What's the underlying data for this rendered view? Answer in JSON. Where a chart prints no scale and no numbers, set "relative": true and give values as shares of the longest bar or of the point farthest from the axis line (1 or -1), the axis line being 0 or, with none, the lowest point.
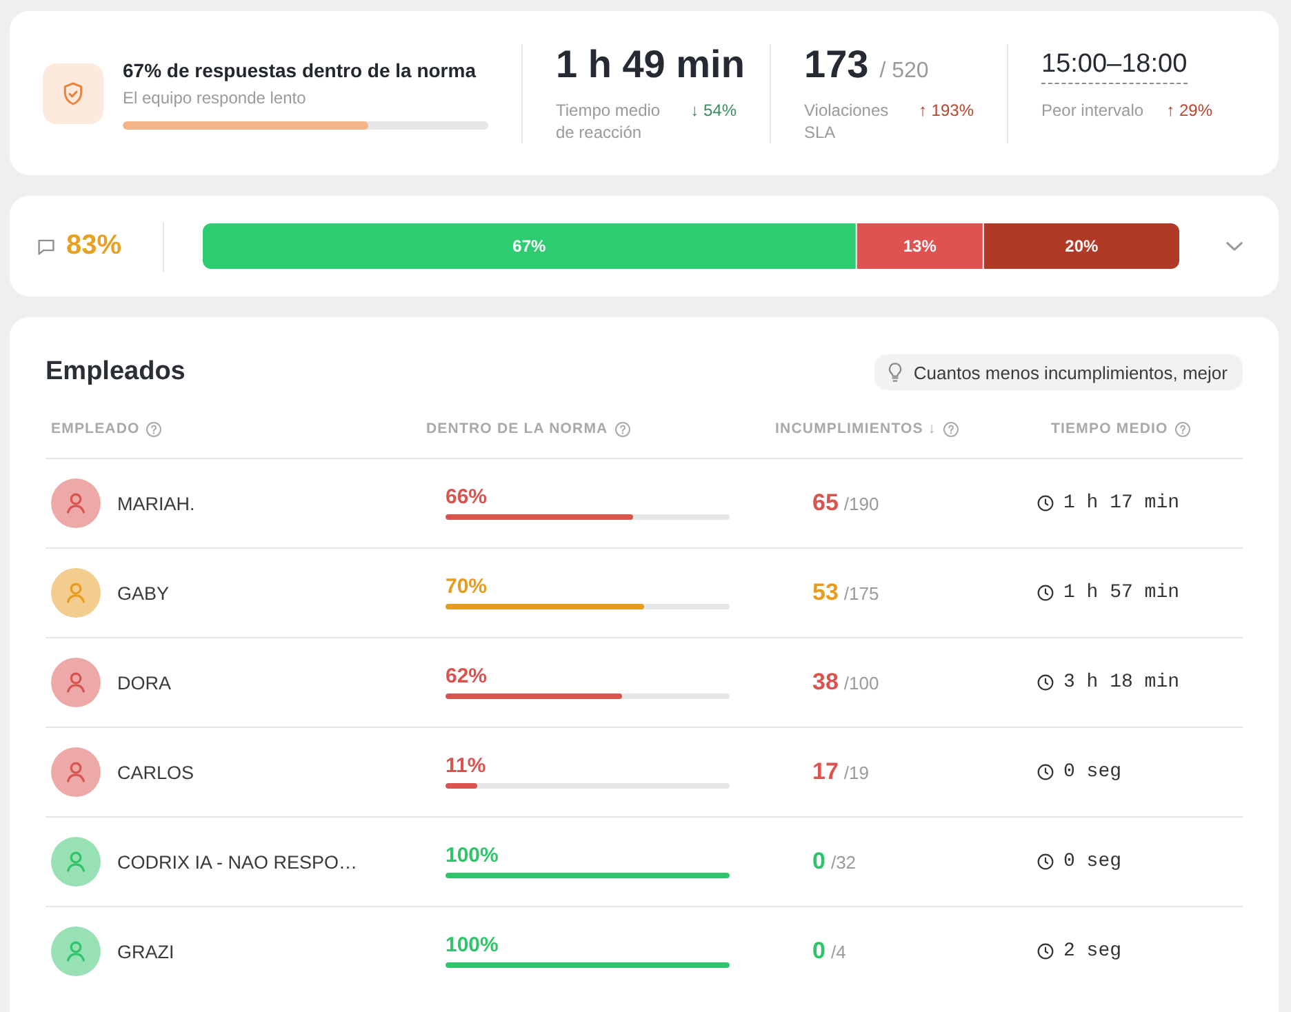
{
  "summary": {
    "title": "67% de respuestas dentro de la norma",
    "subtitle": "El equipo responde lento",
    "level": 0.67
  },
  "stats": [
    {
      "kind": "plain",
      "value": "1 h 49 min",
      "label": "Tiempo medio de reacción",
      "delta": "↓ 54%",
      "positive": true
    },
    {
      "kind": "fraction",
      "value": "173",
      "total": "/ 520",
      "label": "Violaciones SLA",
      "delta": "↑ 193%",
      "positive": false
    },
    {
      "kind": "interval",
      "value": "15:00–18:00",
      "label": "Peor intervalo",
      "delta": "↑ 29%",
      "positive": false
    }
  ],
  "response_rate": {
    "value": "83%",
    "chart_data": {
      "type": "bar",
      "orientation": "horizontal",
      "stacked": true,
      "relative": true,
      "series": [
        {
          "color": "#2ecc71",
          "values": [
            0.67
          ]
        },
        {
          "color": "#e05252",
          "values": [
            0.13
          ]
        },
        {
          "color": "#b03a26",
          "values": [
            0.2
          ]
        }
      ],
      "value_labels": [
        "67%",
        "13%",
        "20%"
      ]
    },
    "expanded": false
  },
  "employees": {
    "title": "Empleados",
    "tip": "Cuantos menos incumplimientos, mejor",
    "columns": [
      {
        "label": "EMPLEADO"
      },
      {
        "label": "DENTRO DE LA NORMA"
      },
      {
        "label": "INCUMPLIMIENTOS ↓"
      },
      {
        "label": "TIEMPO MEDIO"
      }
    ],
    "rows": [
      {
        "name": "MARIAH.",
        "color": "#d9534f",
        "compliance": "66%",
        "level": 0.66,
        "breaches": "65",
        "total": "/190",
        "avg_time": "1 h 17 min"
      },
      {
        "name": "GABY",
        "color": "#e89b1c",
        "compliance": "70%",
        "level": 0.7,
        "breaches": "53",
        "total": "/175",
        "avg_time": "1 h 57 min"
      },
      {
        "name": "DORA",
        "color": "#d9534f",
        "compliance": "62%",
        "level": 0.62,
        "breaches": "38",
        "total": "/100",
        "avg_time": "3 h 18 min"
      },
      {
        "name": "CARLOS",
        "color": "#d9534f",
        "compliance": "11%",
        "level": 0.11,
        "breaches": "17",
        "total": "/19",
        "avg_time": "0 seg"
      },
      {
        "name": "CODRIX IA - NAO RESPO…",
        "color": "#2fc46a",
        "compliance": "100%",
        "level": 1,
        "breaches": "0",
        "total": "/32",
        "avg_time": "0 seg"
      },
      {
        "name": "GRAZI",
        "color": "#2fc46a",
        "compliance": "100%",
        "level": 1,
        "breaches": "0",
        "total": "/4",
        "avg_time": "2 seg"
      }
    ]
  }
}
